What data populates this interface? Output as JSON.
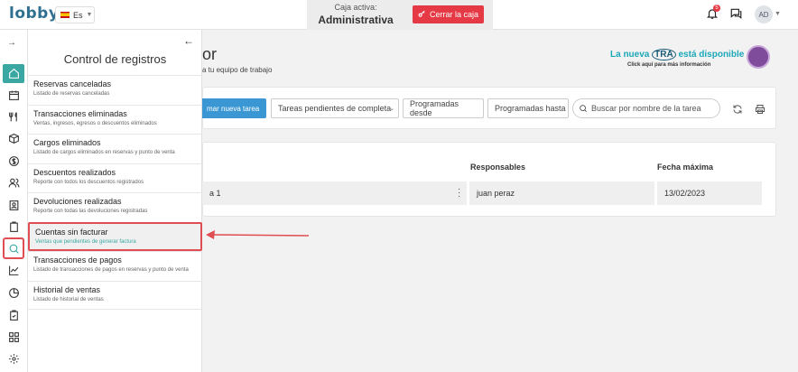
{
  "topbar": {
    "logo": "lobby",
    "language": "Es",
    "caja_label": "Caja activa:",
    "caja_value": "Administrativa",
    "cerrar_button": "Cerrar la caja",
    "notification_count": "5",
    "avatar_initials": "AD"
  },
  "rail": {
    "icons": [
      "home-icon",
      "calendar-icon",
      "utensils-icon",
      "box-icon",
      "dollar-icon",
      "users-icon",
      "contact-book-icon",
      "clipboard-icon",
      "search-icon",
      "chart-line-icon",
      "pie-chart-icon",
      "clipboard-check-icon",
      "grid-icon",
      "settings-icon"
    ]
  },
  "panel": {
    "title": "Control de registros",
    "items": [
      {
        "title": "Reservas canceladas",
        "subtitle": "Listado de reservas canceladas"
      },
      {
        "title": "Transacciones eliminadas",
        "subtitle": "Ventas, ingresos, egresos o descuentos eliminados"
      },
      {
        "title": "Cargos eliminados",
        "subtitle": "Listado de cargos eliminados en reservas y punto de venta"
      },
      {
        "title": "Descuentos realizados",
        "subtitle": "Reporte con todos los descuentos registrados"
      },
      {
        "title": "Devoluciones realizadas",
        "subtitle": "Reporte con todas las devoluciones registradas"
      },
      {
        "title": "Cuentas sin facturar",
        "subtitle": "Ventas que pendientes de generar factura"
      },
      {
        "title": "Transacciones de pagos",
        "subtitle": "Listado de transacciones de pagos en reservas y punto de venta"
      },
      {
        "title": "Historial de ventas",
        "subtitle": "Listado de historial de ventas"
      }
    ]
  },
  "main": {
    "title_fragment": "or",
    "subtitle_fragment": "a tu equipo de trabajo",
    "promo_line1_a": "La nueva",
    "promo_line1_b": "TRA",
    "promo_line1_c": "está disponible",
    "promo_line2": "Click aquí para más información",
    "new_task_button": "mar nueva tarea",
    "filter_select": "Tareas pendientes de completa",
    "programadas_desde": "Programadas desde",
    "programadas_hasta": "Programadas hasta",
    "search_placeholder": "Buscar por nombre de la tarea",
    "table": {
      "headers": {
        "responsables": "Responsables",
        "fecha": "Fecha máxima"
      },
      "row": {
        "task_fragment": "a 1",
        "responsable": "juan peraz",
        "fecha": "13/02/2023"
      }
    }
  },
  "colors": {
    "accent": "#3aa7a3",
    "danger": "#e53945",
    "primary_button": "#3a97d4",
    "highlight_border": "#e04d52"
  }
}
